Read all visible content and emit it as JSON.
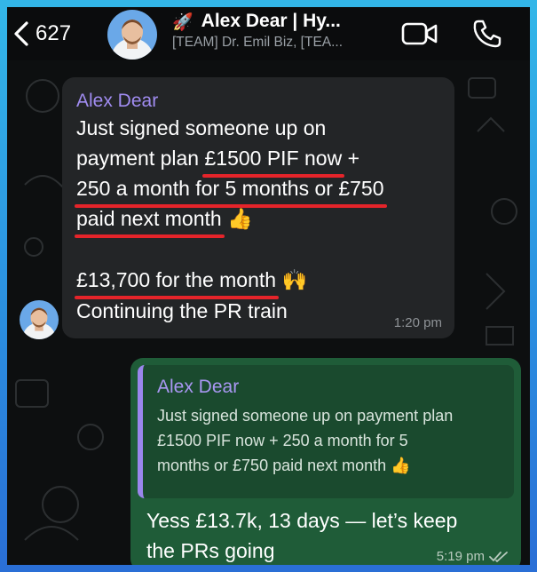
{
  "header": {
    "back_count": "627",
    "title_emoji": "🚀",
    "title": "Alex Dear | Hy...",
    "subtitle": "[TEAM] Dr. Emil Biz, [TEA..."
  },
  "incoming": {
    "sender": "Alex Dear",
    "lines": {
      "l1": "Just signed someone up on",
      "l2_prefix": "payment plan ",
      "l2_highlight": "£1500 PIF now",
      "l2_suffix": " +",
      "l3_highlight": "250 a month for 5 months or £750",
      "l4_highlight": "paid next month",
      "l4_emoji": "👍",
      "l5_highlight": "£13,700 for the month",
      "l5_emoji": "🙌",
      "l6": "Continuing the PR train"
    },
    "time": "1:20 pm",
    "highlight_color": "#e5242a"
  },
  "outgoing": {
    "quote_sender": "Alex Dear",
    "quote_lines": {
      "q1": "Just signed someone up on payment plan",
      "q2": "£1500 PIF now + 250 a month for 5",
      "q3": "months or £750 paid next month",
      "q3_emoji": "👍"
    },
    "reply_lines": {
      "r1": "Yess £13.7k, 13 days — let’s keep",
      "r2": "the PRs going"
    },
    "time": "5:19 pm",
    "status_icon": "double-check-icon"
  },
  "colors": {
    "frame": "#2b8fe0",
    "incoming_bubble": "#232527",
    "outgoing_bubble": "#1f5c38",
    "sender_name": "#a08cf0"
  }
}
